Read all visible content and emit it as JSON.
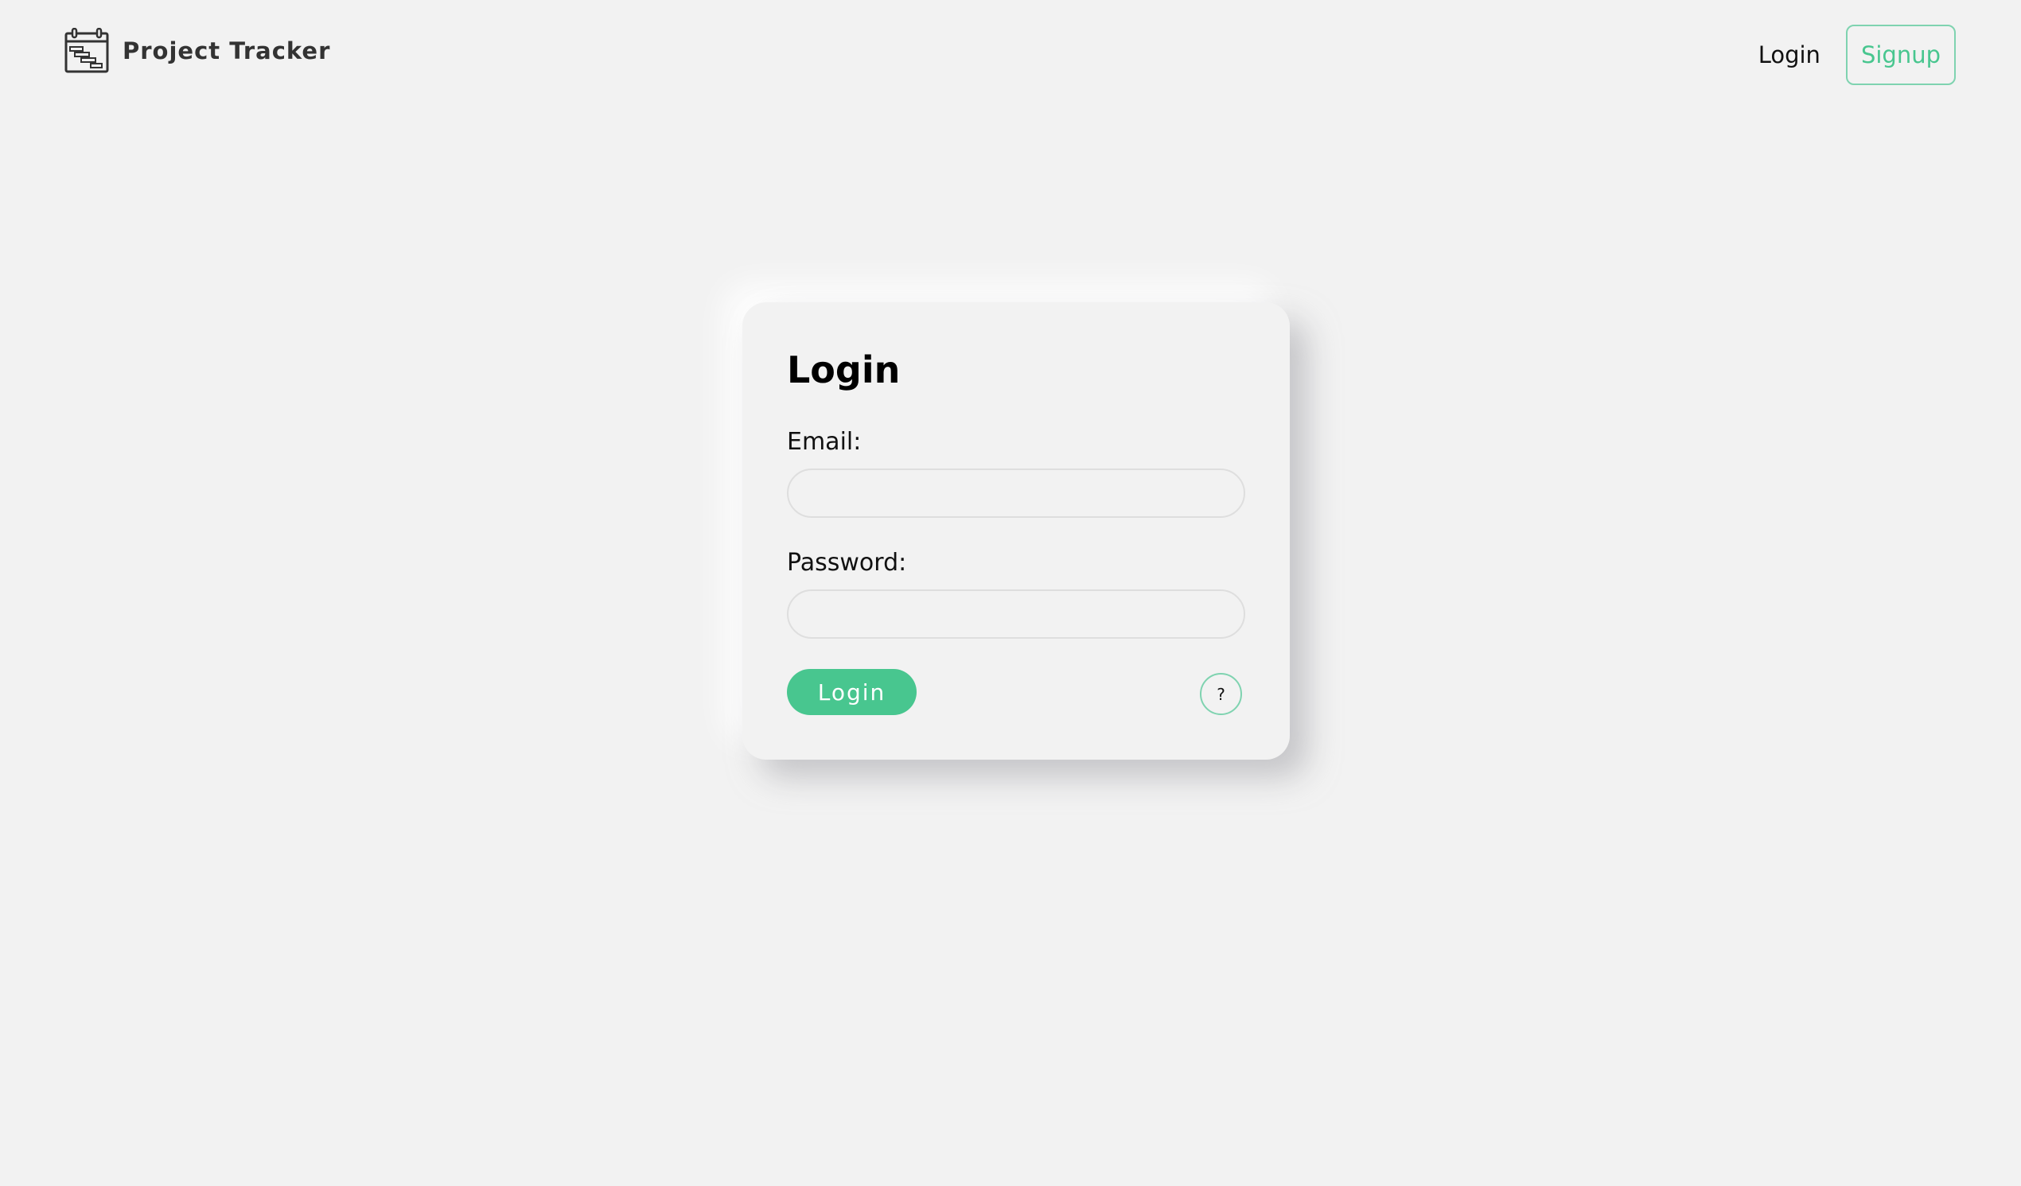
{
  "header": {
    "brand_icon": "gantt-calendar-icon",
    "brand_title": "Project Tracker",
    "nav_login": "Login",
    "nav_signup": "Signup"
  },
  "login_card": {
    "title": "Login",
    "email_label": "Email:",
    "email_value": "",
    "password_label": "Password:",
    "password_value": "",
    "submit_label": "Login",
    "help_label": "?"
  },
  "colors": {
    "background": "#f2f2f2",
    "accent": "#48c68f",
    "accent_border": "#7fd3b0",
    "text": "#111111"
  }
}
